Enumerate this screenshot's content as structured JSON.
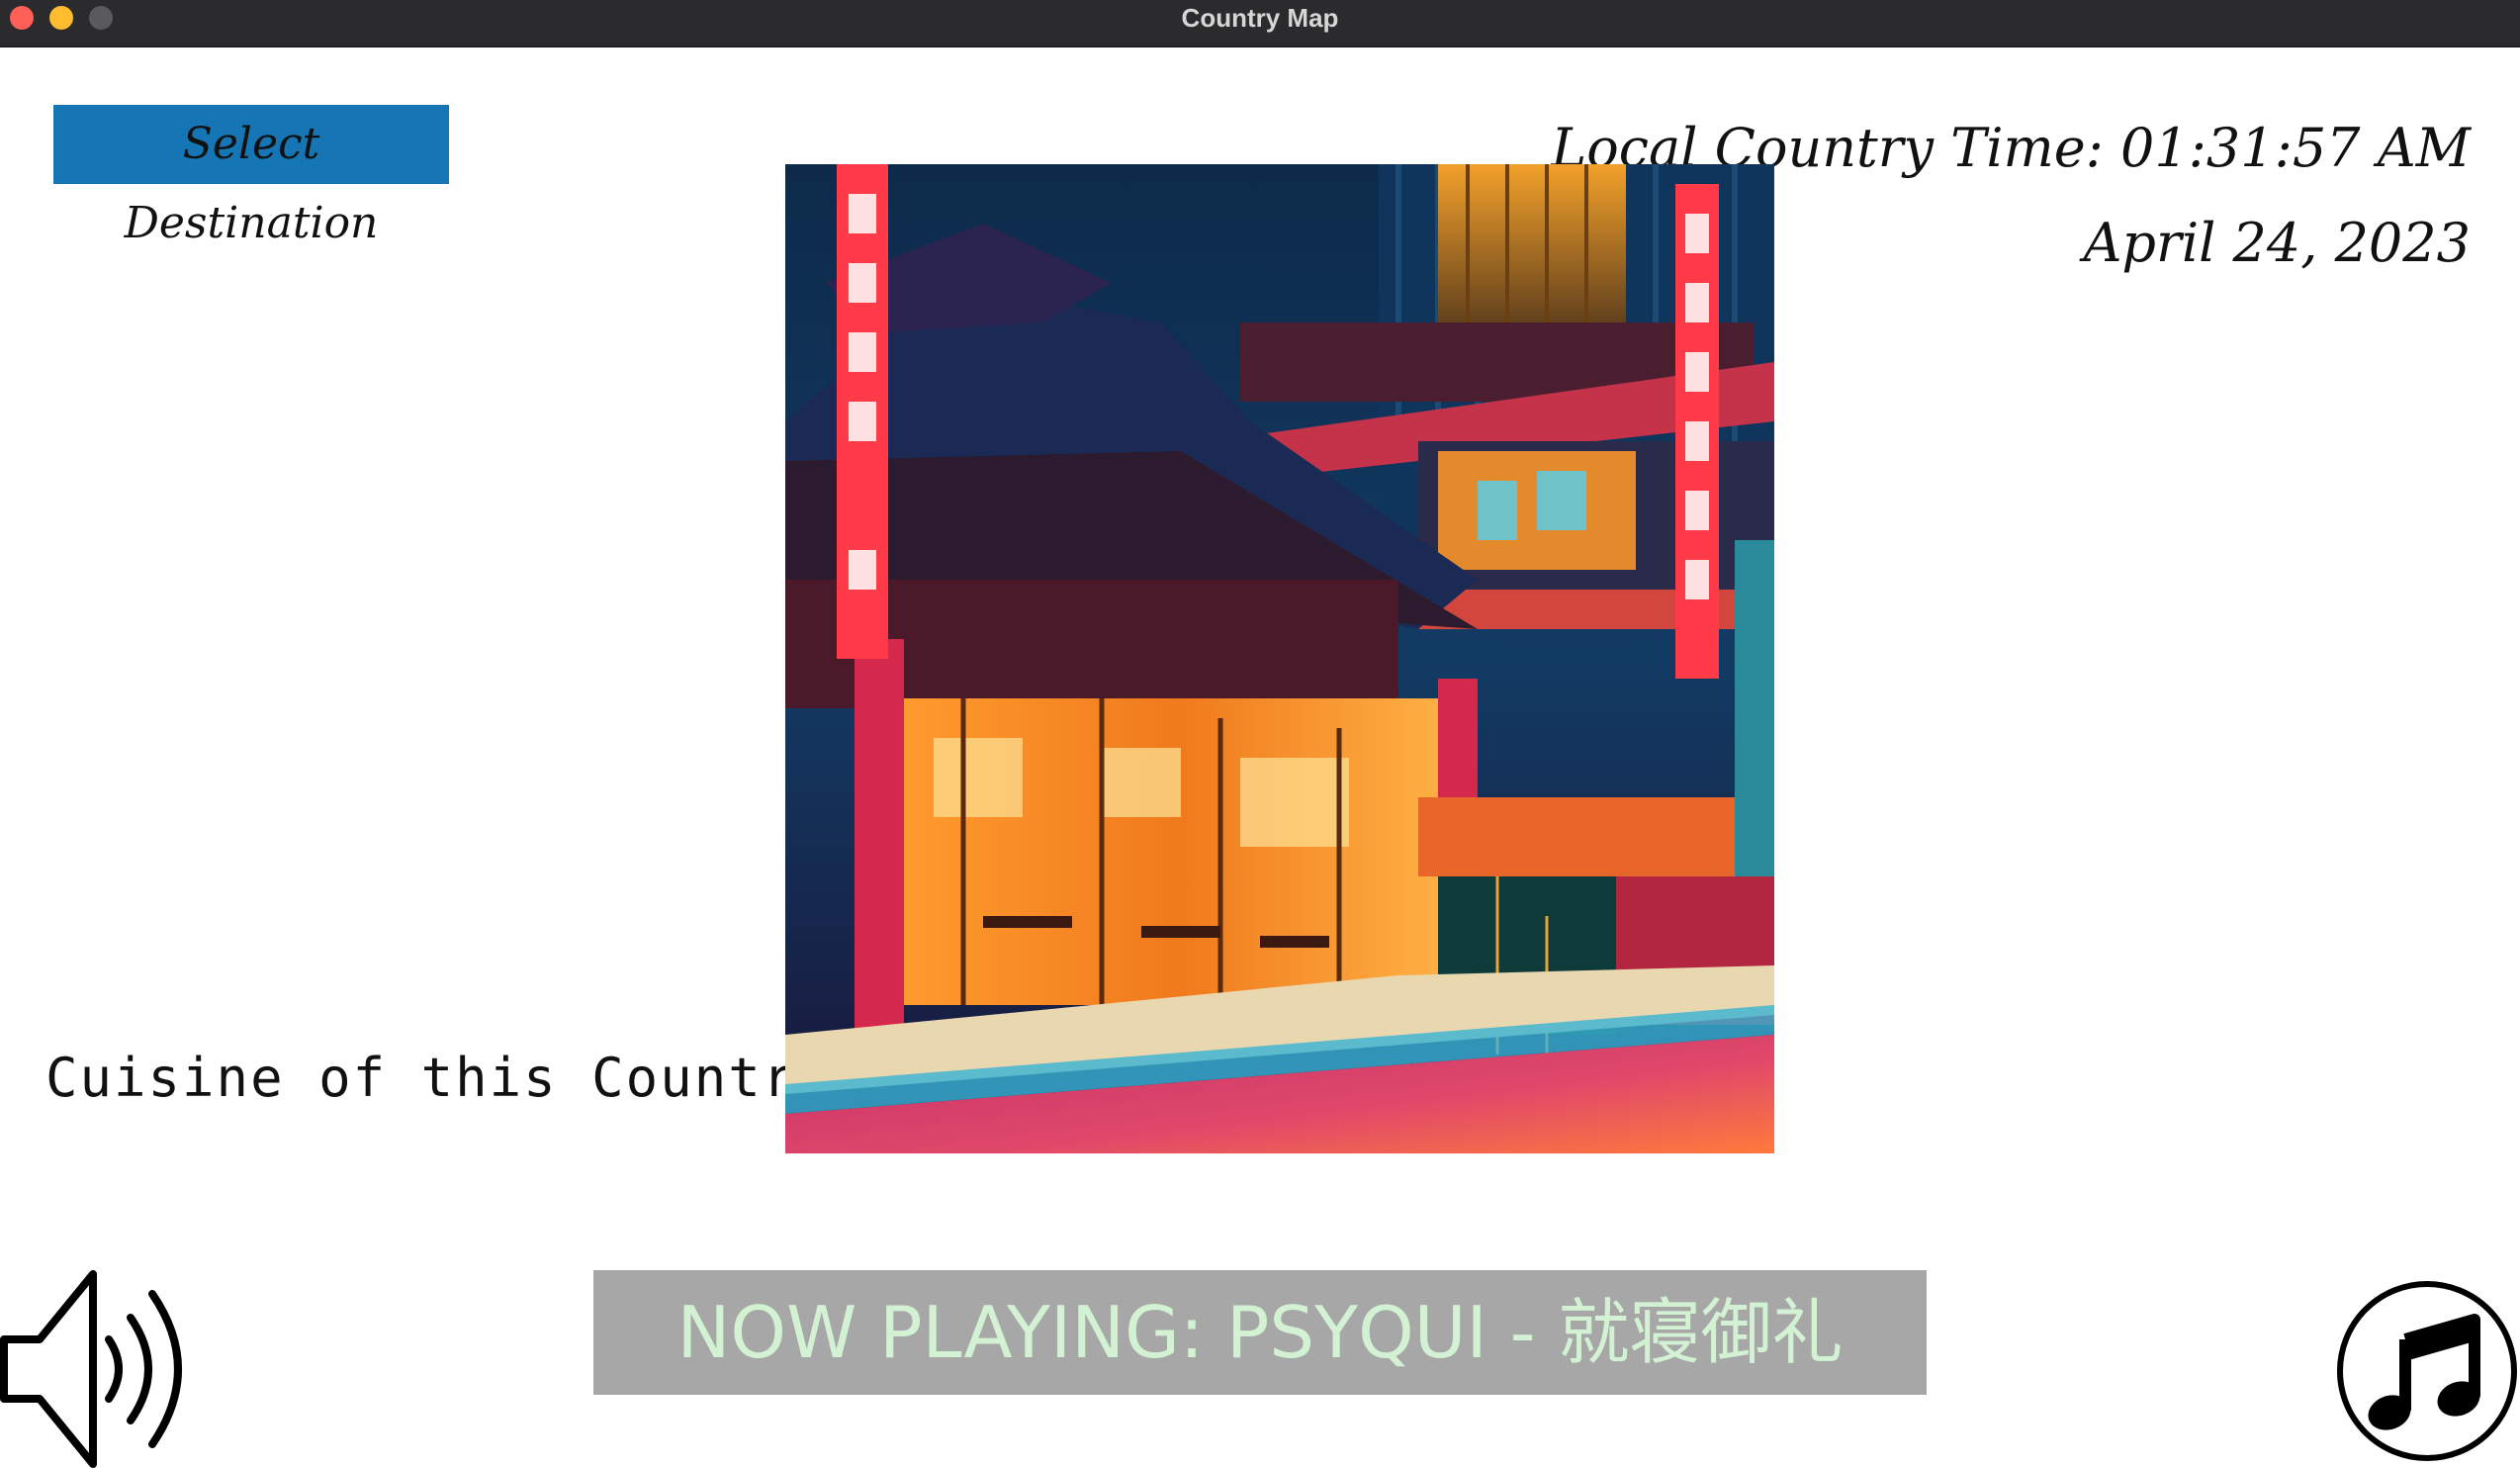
{
  "window": {
    "title": "Country Map"
  },
  "header": {
    "select_destination_label": "Select Destination",
    "local_time": "Local Country Time: 01:31:57 AM",
    "date": "April 24, 2023"
  },
  "main": {
    "cuisine_label": "Cuisine of this Country",
    "image_icon": "city-street-night-image"
  },
  "footer": {
    "now_playing": "NOW PLAYING: PSYQUI - 就寝御礼",
    "volume_icon": "speaker-icon",
    "music_icon": "music-note-icon"
  },
  "colors": {
    "button_bg": "#1676b5",
    "now_playing_bg": "#a7a7a7",
    "now_playing_text": "#d3f2d3",
    "titlebar_bg": "#2b2b2d"
  }
}
